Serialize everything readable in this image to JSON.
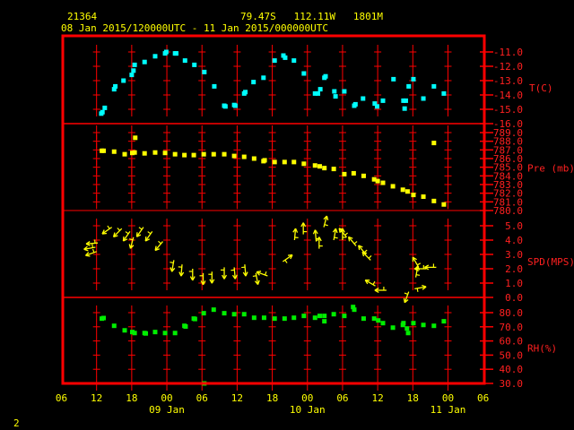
{
  "header": {
    "station": "21364",
    "location": "79.47S   112.11W   1801M",
    "period": "08 Jan 2015/120000UTC - 11 Jan 2015/000000UTC"
  },
  "footer": {
    "page_number": "2"
  },
  "colors": {
    "frame": "#ff0000",
    "axis_text": "#ff2020",
    "header_text": "#ffff00",
    "temp": "#00ffff",
    "pressure": "#ffff00",
    "wind": "#ffff00",
    "rh": "#00ee00"
  },
  "chart_data": {
    "type": "scatter",
    "xaxis": {
      "unit": "hours since 08 Jan 06UTC",
      "range": [
        0,
        72
      ],
      "tick_labels": [
        "06",
        "12",
        "18",
        "00",
        "06",
        "12",
        "18",
        "00",
        "06",
        "12",
        "18",
        "00",
        "06"
      ],
      "day_labels": [
        {
          "label": "09 Jan",
          "hour": 18
        },
        {
          "label": "10 Jan",
          "hour": 42
        },
        {
          "label": "11 Jan",
          "hour": 66
        }
      ]
    },
    "panels": [
      {
        "name": "temperature",
        "label": "T(C)",
        "ylim": [
          -16,
          -11
        ],
        "tick_labels": [
          "-11.0",
          "-12.0",
          "-13.0",
          "-14.0",
          "-15.0",
          "-16.0"
        ],
        "points": [
          [
            6.8,
            -15.3
          ],
          [
            7.0,
            -15.2
          ],
          [
            7.4,
            -14.9
          ],
          [
            9.0,
            -13.6
          ],
          [
            9.2,
            -13.4
          ],
          [
            10.6,
            -13.0
          ],
          [
            12.0,
            -12.6
          ],
          [
            12.3,
            -12.3
          ],
          [
            12.5,
            -11.9
          ],
          [
            14.2,
            -11.7
          ],
          [
            16.0,
            -11.3
          ],
          [
            17.7,
            -11.1
          ],
          [
            17.9,
            -11.0
          ],
          [
            19.4,
            -11.1
          ],
          [
            19.6,
            -11.1
          ],
          [
            21.1,
            -11.6
          ],
          [
            22.7,
            -11.9
          ],
          [
            24.4,
            -12.4
          ],
          [
            26.1,
            -13.4
          ],
          [
            27.8,
            -14.75
          ],
          [
            28.0,
            -14.8
          ],
          [
            29.5,
            -14.7
          ],
          [
            29.7,
            -14.75
          ],
          [
            31.2,
            -13.9
          ],
          [
            31.4,
            -13.8
          ],
          [
            32.8,
            -13.1
          ],
          [
            34.5,
            -12.8
          ],
          [
            36.4,
            -11.6
          ],
          [
            37.9,
            -11.25
          ],
          [
            38.2,
            -11.4
          ],
          [
            39.7,
            -11.6
          ],
          [
            41.4,
            -12.5
          ],
          [
            43.3,
            -13.9
          ],
          [
            43.8,
            -13.9
          ],
          [
            44.2,
            -13.6
          ],
          [
            44.9,
            -12.8
          ],
          [
            45.1,
            -12.7
          ],
          [
            46.6,
            -13.75
          ],
          [
            46.8,
            -14.1
          ],
          [
            48.3,
            -13.75
          ],
          [
            50.0,
            -14.75
          ],
          [
            50.2,
            -14.65
          ],
          [
            51.5,
            -14.25
          ],
          [
            53.5,
            -14.6
          ],
          [
            53.9,
            -14.8
          ],
          [
            54.9,
            -14.4
          ],
          [
            56.7,
            -12.9
          ],
          [
            58.4,
            -14.4
          ],
          [
            58.6,
            -14.95
          ],
          [
            58.8,
            -14.4
          ],
          [
            59.3,
            -13.4
          ],
          [
            60.1,
            -12.9
          ],
          [
            61.8,
            -14.25
          ],
          [
            63.6,
            -13.4
          ],
          [
            65.3,
            -13.9
          ]
        ]
      },
      {
        "name": "pressure",
        "label": "Pre (mb)",
        "ylim": [
          780,
          789
        ],
        "tick_labels": [
          "789.0",
          "788.0",
          "787.0",
          "786.0",
          "785.0",
          "784.0",
          "783.0",
          "782.0",
          "781.0",
          "780.0"
        ],
        "points": [
          [
            6.9,
            786.9
          ],
          [
            7.2,
            786.9
          ],
          [
            9.0,
            786.8
          ],
          [
            10.8,
            786.5
          ],
          [
            12.1,
            786.65
          ],
          [
            12.5,
            786.7
          ],
          [
            14.2,
            786.6
          ],
          [
            16.0,
            786.7
          ],
          [
            17.7,
            786.65
          ],
          [
            19.4,
            786.5
          ],
          [
            21.0,
            786.4
          ],
          [
            22.6,
            786.4
          ],
          [
            24.3,
            786.5
          ],
          [
            26.0,
            786.5
          ],
          [
            27.8,
            786.5
          ],
          [
            29.5,
            786.3
          ],
          [
            31.2,
            786.2
          ],
          [
            32.9,
            786.0
          ],
          [
            34.5,
            785.7
          ],
          [
            34.7,
            785.8
          ],
          [
            36.4,
            785.6
          ],
          [
            38.1,
            785.6
          ],
          [
            39.7,
            785.6
          ],
          [
            41.4,
            785.4
          ],
          [
            43.3,
            785.2
          ],
          [
            44.1,
            785.1
          ],
          [
            44.9,
            784.9
          ],
          [
            46.5,
            784.8
          ],
          [
            48.3,
            784.2
          ],
          [
            49.9,
            784.3
          ],
          [
            51.6,
            784.0
          ],
          [
            53.4,
            783.6
          ],
          [
            54.0,
            783.4
          ],
          [
            54.9,
            783.2
          ],
          [
            56.6,
            782.8
          ],
          [
            58.3,
            782.4
          ],
          [
            59.1,
            782.2
          ],
          [
            60.1,
            781.8
          ],
          [
            61.8,
            781.6
          ],
          [
            63.6,
            781.1
          ],
          [
            65.3,
            780.7
          ],
          [
            12.6,
            788.4
          ],
          [
            63.6,
            787.8
          ]
        ]
      },
      {
        "name": "wind_speed",
        "label": "SPD(MPS)",
        "ylim": [
          0,
          5
        ],
        "tick_labels": [
          "5.0",
          "4.0",
          "3.0",
          "2.0",
          "1.0",
          "0.0"
        ],
        "points_hour_speed_toward_deg": [
          [
            5.8,
            3.5,
            260
          ],
          [
            6.0,
            3.2,
            250
          ],
          [
            6.2,
            3.8,
            265
          ],
          [
            8.6,
            4.9,
            235
          ],
          [
            10.3,
            4.8,
            225
          ],
          [
            11.7,
            4.6,
            215
          ],
          [
            12.3,
            4.2,
            195
          ],
          [
            14.0,
            4.9,
            215
          ],
          [
            15.5,
            4.6,
            215
          ],
          [
            17.3,
            3.9,
            220
          ],
          [
            19.2,
            2.6,
            190
          ],
          [
            20.6,
            2.3,
            185
          ],
          [
            22.4,
            2.0,
            180
          ],
          [
            24.2,
            1.7,
            180
          ],
          [
            25.7,
            1.8,
            180
          ],
          [
            27.8,
            2.1,
            180
          ],
          [
            29.5,
            2.1,
            175
          ],
          [
            31.3,
            2.3,
            175
          ],
          [
            33.2,
            1.7,
            170
          ],
          [
            35.2,
            1.5,
            290
          ],
          [
            37.8,
            2.5,
            55
          ],
          [
            39.8,
            4.0,
            5
          ],
          [
            41.3,
            4.4,
            0
          ],
          [
            43.5,
            3.9,
            355
          ],
          [
            44.0,
            3.4,
            0
          ],
          [
            44.8,
            4.9,
            15
          ],
          [
            46.5,
            4.0,
            10
          ],
          [
            48.0,
            4.0,
            0
          ],
          [
            48.7,
            4.2,
            320
          ],
          [
            50.3,
            3.6,
            320
          ],
          [
            52.0,
            3.0,
            320
          ],
          [
            52.8,
            2.6,
            315
          ],
          [
            53.6,
            0.8,
            300
          ],
          [
            55.5,
            0.5,
            270
          ],
          [
            59.3,
            0.4,
            200
          ],
          [
            60.3,
            0.6,
            80
          ],
          [
            60.5,
            1.4,
            10
          ],
          [
            61.0,
            2.1,
            330
          ],
          [
            62.3,
            2.0,
            270
          ],
          [
            64.0,
            2.1,
            270
          ]
        ]
      },
      {
        "name": "relative_humidity",
        "label": "RH(%)",
        "ylim": [
          30,
          80
        ],
        "tick_labels": [
          "80.0",
          "70.0",
          "60.0",
          "50.0",
          "40.0",
          "30.0"
        ],
        "points": [
          [
            6.9,
            75.8
          ],
          [
            7.2,
            76.2
          ],
          [
            9.0,
            70.7
          ],
          [
            10.8,
            67.5
          ],
          [
            12.1,
            66.3
          ],
          [
            12.5,
            65.6
          ],
          [
            14.2,
            65.6
          ],
          [
            14.4,
            65.3
          ],
          [
            16.0,
            66.3
          ],
          [
            17.7,
            65.6
          ],
          [
            19.4,
            65.6
          ],
          [
            21.0,
            70.7
          ],
          [
            21.2,
            70.2
          ],
          [
            22.6,
            75.8
          ],
          [
            22.8,
            75.5
          ],
          [
            24.3,
            79.6
          ],
          [
            24.4,
            30.0
          ],
          [
            26.0,
            82.1
          ],
          [
            27.8,
            79.6
          ],
          [
            29.5,
            78.9
          ],
          [
            31.2,
            78.9
          ],
          [
            32.9,
            76.4
          ],
          [
            34.6,
            76.4
          ],
          [
            36.4,
            75.8
          ],
          [
            38.1,
            75.8
          ],
          [
            39.7,
            76.4
          ],
          [
            41.4,
            77.7
          ],
          [
            43.3,
            76.4
          ],
          [
            44.1,
            77.7
          ],
          [
            44.9,
            77.7
          ],
          [
            44.9,
            73.9
          ],
          [
            46.5,
            78.9
          ],
          [
            48.3,
            77.7
          ],
          [
            49.8,
            84.0
          ],
          [
            50.0,
            82.1
          ],
          [
            51.6,
            75.8
          ],
          [
            53.4,
            75.8
          ],
          [
            54.1,
            74.5
          ],
          [
            54.9,
            72.6
          ],
          [
            56.6,
            69.4
          ],
          [
            58.3,
            71.3
          ],
          [
            58.4,
            72.6
          ],
          [
            59.0,
            68.8
          ],
          [
            59.2,
            65.6
          ],
          [
            60.1,
            72.6
          ],
          [
            61.8,
            71.3
          ],
          [
            63.6,
            70.7
          ],
          [
            65.3,
            73.9
          ]
        ]
      }
    ]
  }
}
